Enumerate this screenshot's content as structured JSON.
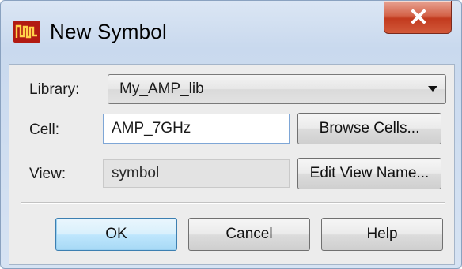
{
  "window": {
    "title": "New Symbol",
    "icon": "app-waveform-icon",
    "accent_color": "#b21a12",
    "close_icon": "close-icon"
  },
  "form": {
    "library": {
      "label": "Library:",
      "value": "My_AMP_lib"
    },
    "cell": {
      "label": "Cell:",
      "value": "AMP_7GHz"
    },
    "view": {
      "label": "View:",
      "value": "symbol"
    }
  },
  "buttons": {
    "browse_cells": "Browse Cells...",
    "edit_view_name": "Edit View Name...",
    "ok": "OK",
    "cancel": "Cancel",
    "help": "Help"
  }
}
